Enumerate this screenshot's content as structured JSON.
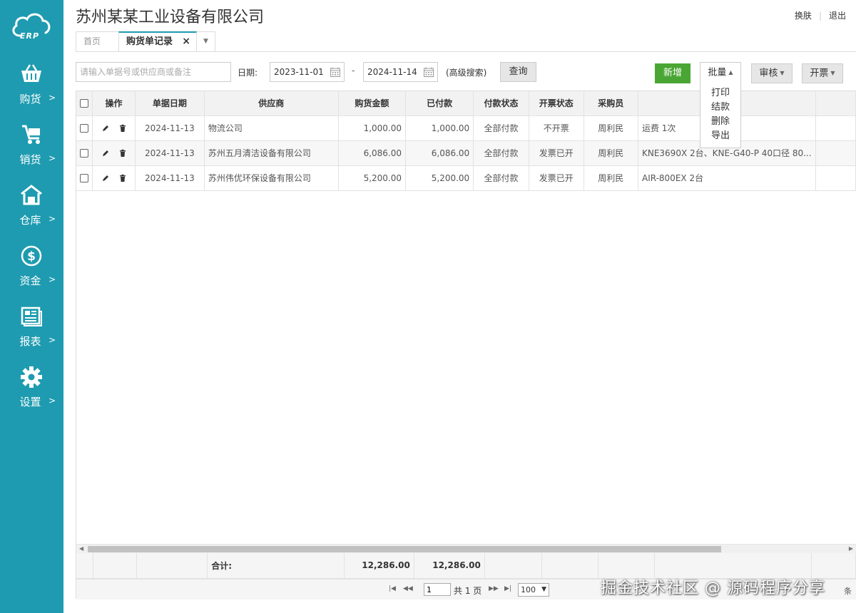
{
  "app": {
    "logo_text": "ERP",
    "company_name": "苏州某某工业设备有限公司"
  },
  "top_links": {
    "skin": "换肤",
    "logout": "退出"
  },
  "sidebar": {
    "items": [
      {
        "label": "购货",
        "icon": "basket-icon"
      },
      {
        "label": "销货",
        "icon": "cart-icon"
      },
      {
        "label": "仓库",
        "icon": "warehouse-icon"
      },
      {
        "label": "资金",
        "icon": "dollar-icon"
      },
      {
        "label": "报表",
        "icon": "report-icon"
      },
      {
        "label": "设置",
        "icon": "gear-icon"
      }
    ],
    "arrow": ">"
  },
  "tabs": {
    "home": "首页",
    "active": "购货单记录",
    "close": "×",
    "more": "▼"
  },
  "toolbar": {
    "search_placeholder": "请输入单据号或供应商或备注",
    "date_label": "日期:",
    "date_from": "2023-11-01",
    "date_sep": "-",
    "date_to": "2024-11-14",
    "advanced_search": "(高级搜索)",
    "query_button": "查询",
    "new_button": "新增",
    "batch_button": "批量",
    "audit_button": "审核",
    "invoice_button": "开票",
    "batch_menu": [
      "打印",
      "结款",
      "删除",
      "导出"
    ]
  },
  "table": {
    "headers": [
      "操作",
      "单据日期",
      "供应商",
      "购货金额",
      "已付款",
      "付款状态",
      "开票状态",
      "采购员",
      ""
    ],
    "rows": [
      {
        "date": "2024-11-13",
        "supplier": "物流公司",
        "amount": "1,000.00",
        "paid": "1,000.00",
        "pay_status": "全部付款",
        "invoice_status": "不开票",
        "buyer": "周利民",
        "note": "运费 1次"
      },
      {
        "date": "2024-11-13",
        "supplier": "苏州五月清洁设备有限公司",
        "amount": "6,086.00",
        "paid": "6,086.00",
        "pay_status": "全部付款",
        "invoice_status": "发票已开",
        "buyer": "周利民",
        "note": "KNE3690X 2台、KNE-G40-P  40口径 80..."
      },
      {
        "date": "2024-11-13",
        "supplier": "苏州伟优环保设备有限公司",
        "amount": "5,200.00",
        "paid": "5,200.00",
        "pay_status": "全部付款",
        "invoice_status": "发票已开",
        "buyer": "周利民",
        "note": "AIR-800EX 2台"
      }
    ],
    "footer": {
      "label": "合计:",
      "amount_total": "12,286.00",
      "paid_total": "12,286.00"
    }
  },
  "pager": {
    "first": "|◀",
    "prev": "◀◀",
    "next": "▶▶",
    "last": "▶|",
    "current_page": "1",
    "total_pages": "共 1 页",
    "page_size": "100",
    "records": "条"
  },
  "watermark": "掘金技术社区 @ 源码程序分享",
  "colors": {
    "sidebar": "#1e9bb0",
    "new_button": "#4aa634"
  }
}
